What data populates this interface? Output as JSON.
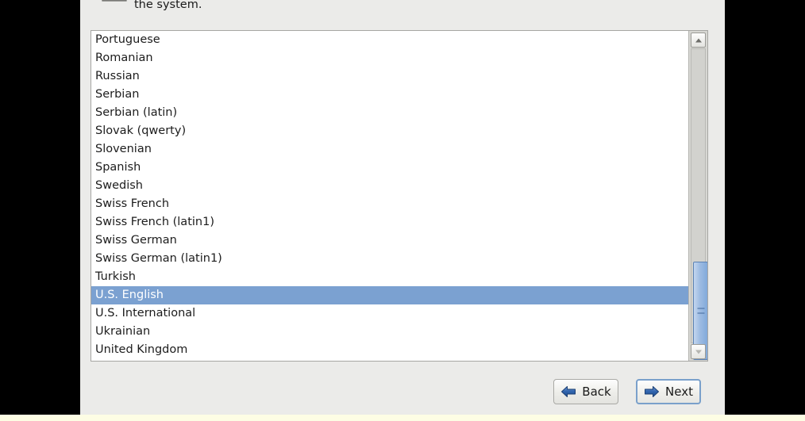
{
  "window": {
    "background_color": "#000000",
    "dialog_background": "#ebebe9",
    "bottom_strip_color": "#fdfde4"
  },
  "header": {
    "icon": "keyboard-icon",
    "description_tail": "the system."
  },
  "keyboard_list": {
    "selected": "U.S. English",
    "selection_color": "#7ba1d1",
    "items": [
      "Portuguese",
      "Romanian",
      "Russian",
      "Serbian",
      "Serbian (latin)",
      "Slovak (qwerty)",
      "Slovenian",
      "Spanish",
      "Swedish",
      "Swiss French",
      "Swiss French (latin1)",
      "Swiss German",
      "Swiss German (latin1)",
      "Turkish",
      "U.S. English",
      "U.S. International",
      "Ukrainian",
      "United Kingdom"
    ]
  },
  "scrollbar": {
    "up_icon": "chevron-up-icon",
    "down_icon": "chevron-down-icon",
    "thumb_color": "#9dbbe2",
    "orientation": "vertical"
  },
  "footer": {
    "back": {
      "label": "Back",
      "icon": "arrow-left-icon",
      "icon_color": "#2a5ca8"
    },
    "next": {
      "label": "Next",
      "icon": "arrow-right-icon",
      "icon_color": "#2a5ca8",
      "focused": true
    }
  }
}
